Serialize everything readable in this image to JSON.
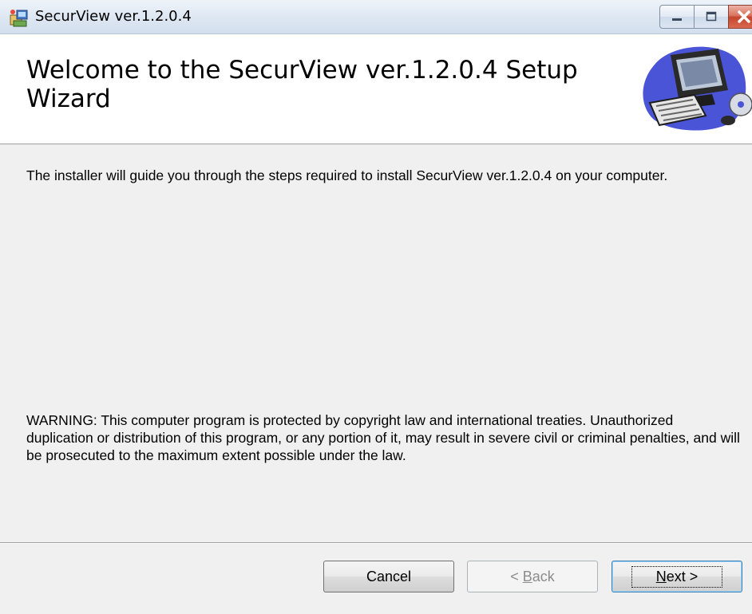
{
  "window": {
    "title": "SecurView ver.1.2.0.4",
    "icon": "setup-installer-icon",
    "controls": [
      "minimize-icon",
      "maximize-icon",
      "close-icon"
    ]
  },
  "header": {
    "title": "Welcome to the SecurView ver.1.2.0.4 Setup Wizard",
    "image": "computer-setup-illustration"
  },
  "body": {
    "intro": "The installer will guide you through the steps required to install SecurView ver.1.2.0.4 on your computer.",
    "warning": "WARNING: This computer program is protected by copyright law and international treaties. Unauthorized duplication or distribution of this program, or any portion of it, may result in severe civil or criminal penalties, and will be prosecuted to the maximum extent possible under the law."
  },
  "buttons": {
    "cancel": "Cancel",
    "back_prefix": "< ",
    "back_key": "B",
    "back_rest": "ack",
    "back_enabled": false,
    "next_key": "N",
    "next_rest": "ext >"
  },
  "colors": {
    "titlebar": "#dde7f2",
    "close_button": "#c4452e",
    "dialog_background": "#f0f0f0",
    "header_background": "#ffffff",
    "disabled_text": "#8c8c8c"
  }
}
